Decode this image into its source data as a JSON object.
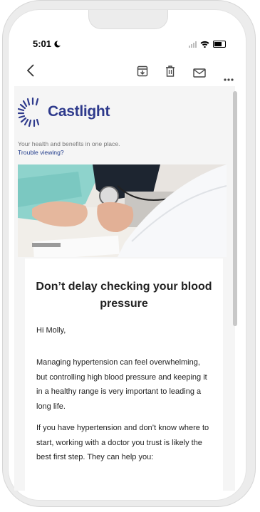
{
  "status": {
    "time": "5:01"
  },
  "toolbar": {
    "back": "back-arrow-icon",
    "archive": "archive-icon",
    "delete": "trash-icon",
    "mark": "mail-icon",
    "more": "more-icon"
  },
  "email": {
    "brand": "Castlight",
    "tagline": "Your health and benefits in one place.",
    "trouble_link": "Trouble viewing?",
    "headline": "Don’t delay checking your blood pressure",
    "greeting": "Hi Molly,",
    "paragraph1": "Managing hypertension can feel overwhelming, but controlling high blood pressure and keeping it in a healthy range is very important to leading a long life.",
    "paragraph2": "If you have hypertension and don’t know where to start, working with a doctor you trust is likely the best first step. They can help you:"
  },
  "colors": {
    "brand": "#2e3a8c",
    "link": "#1f3a8a"
  }
}
